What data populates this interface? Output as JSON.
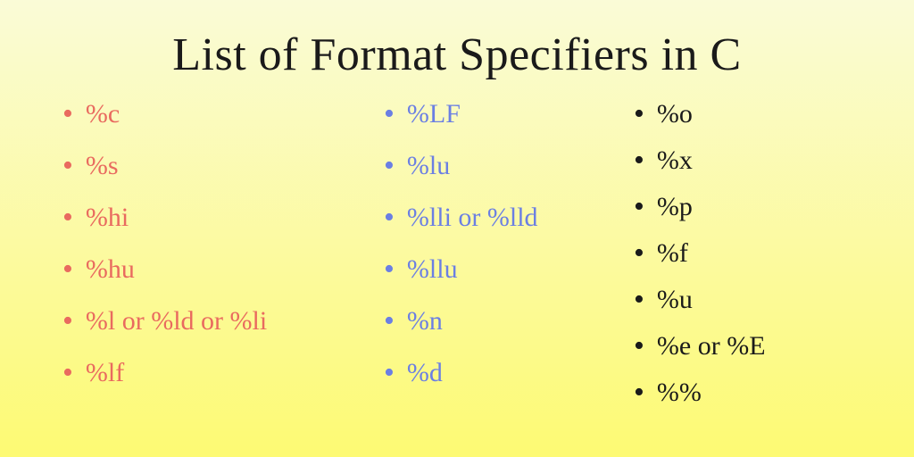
{
  "title": "List of Format Specifiers in C",
  "columns": {
    "col1": [
      "%c",
      "%s",
      "%hi",
      "%hu",
      "%l or %ld or %li",
      "%lf"
    ],
    "col2": [
      "%LF",
      "%lu",
      "%lli or %lld",
      "%llu",
      "%n",
      "%d"
    ],
    "col3": [
      "%o",
      "%x",
      "%p",
      "%f",
      "%u",
      "%e or %E",
      "%%"
    ]
  }
}
